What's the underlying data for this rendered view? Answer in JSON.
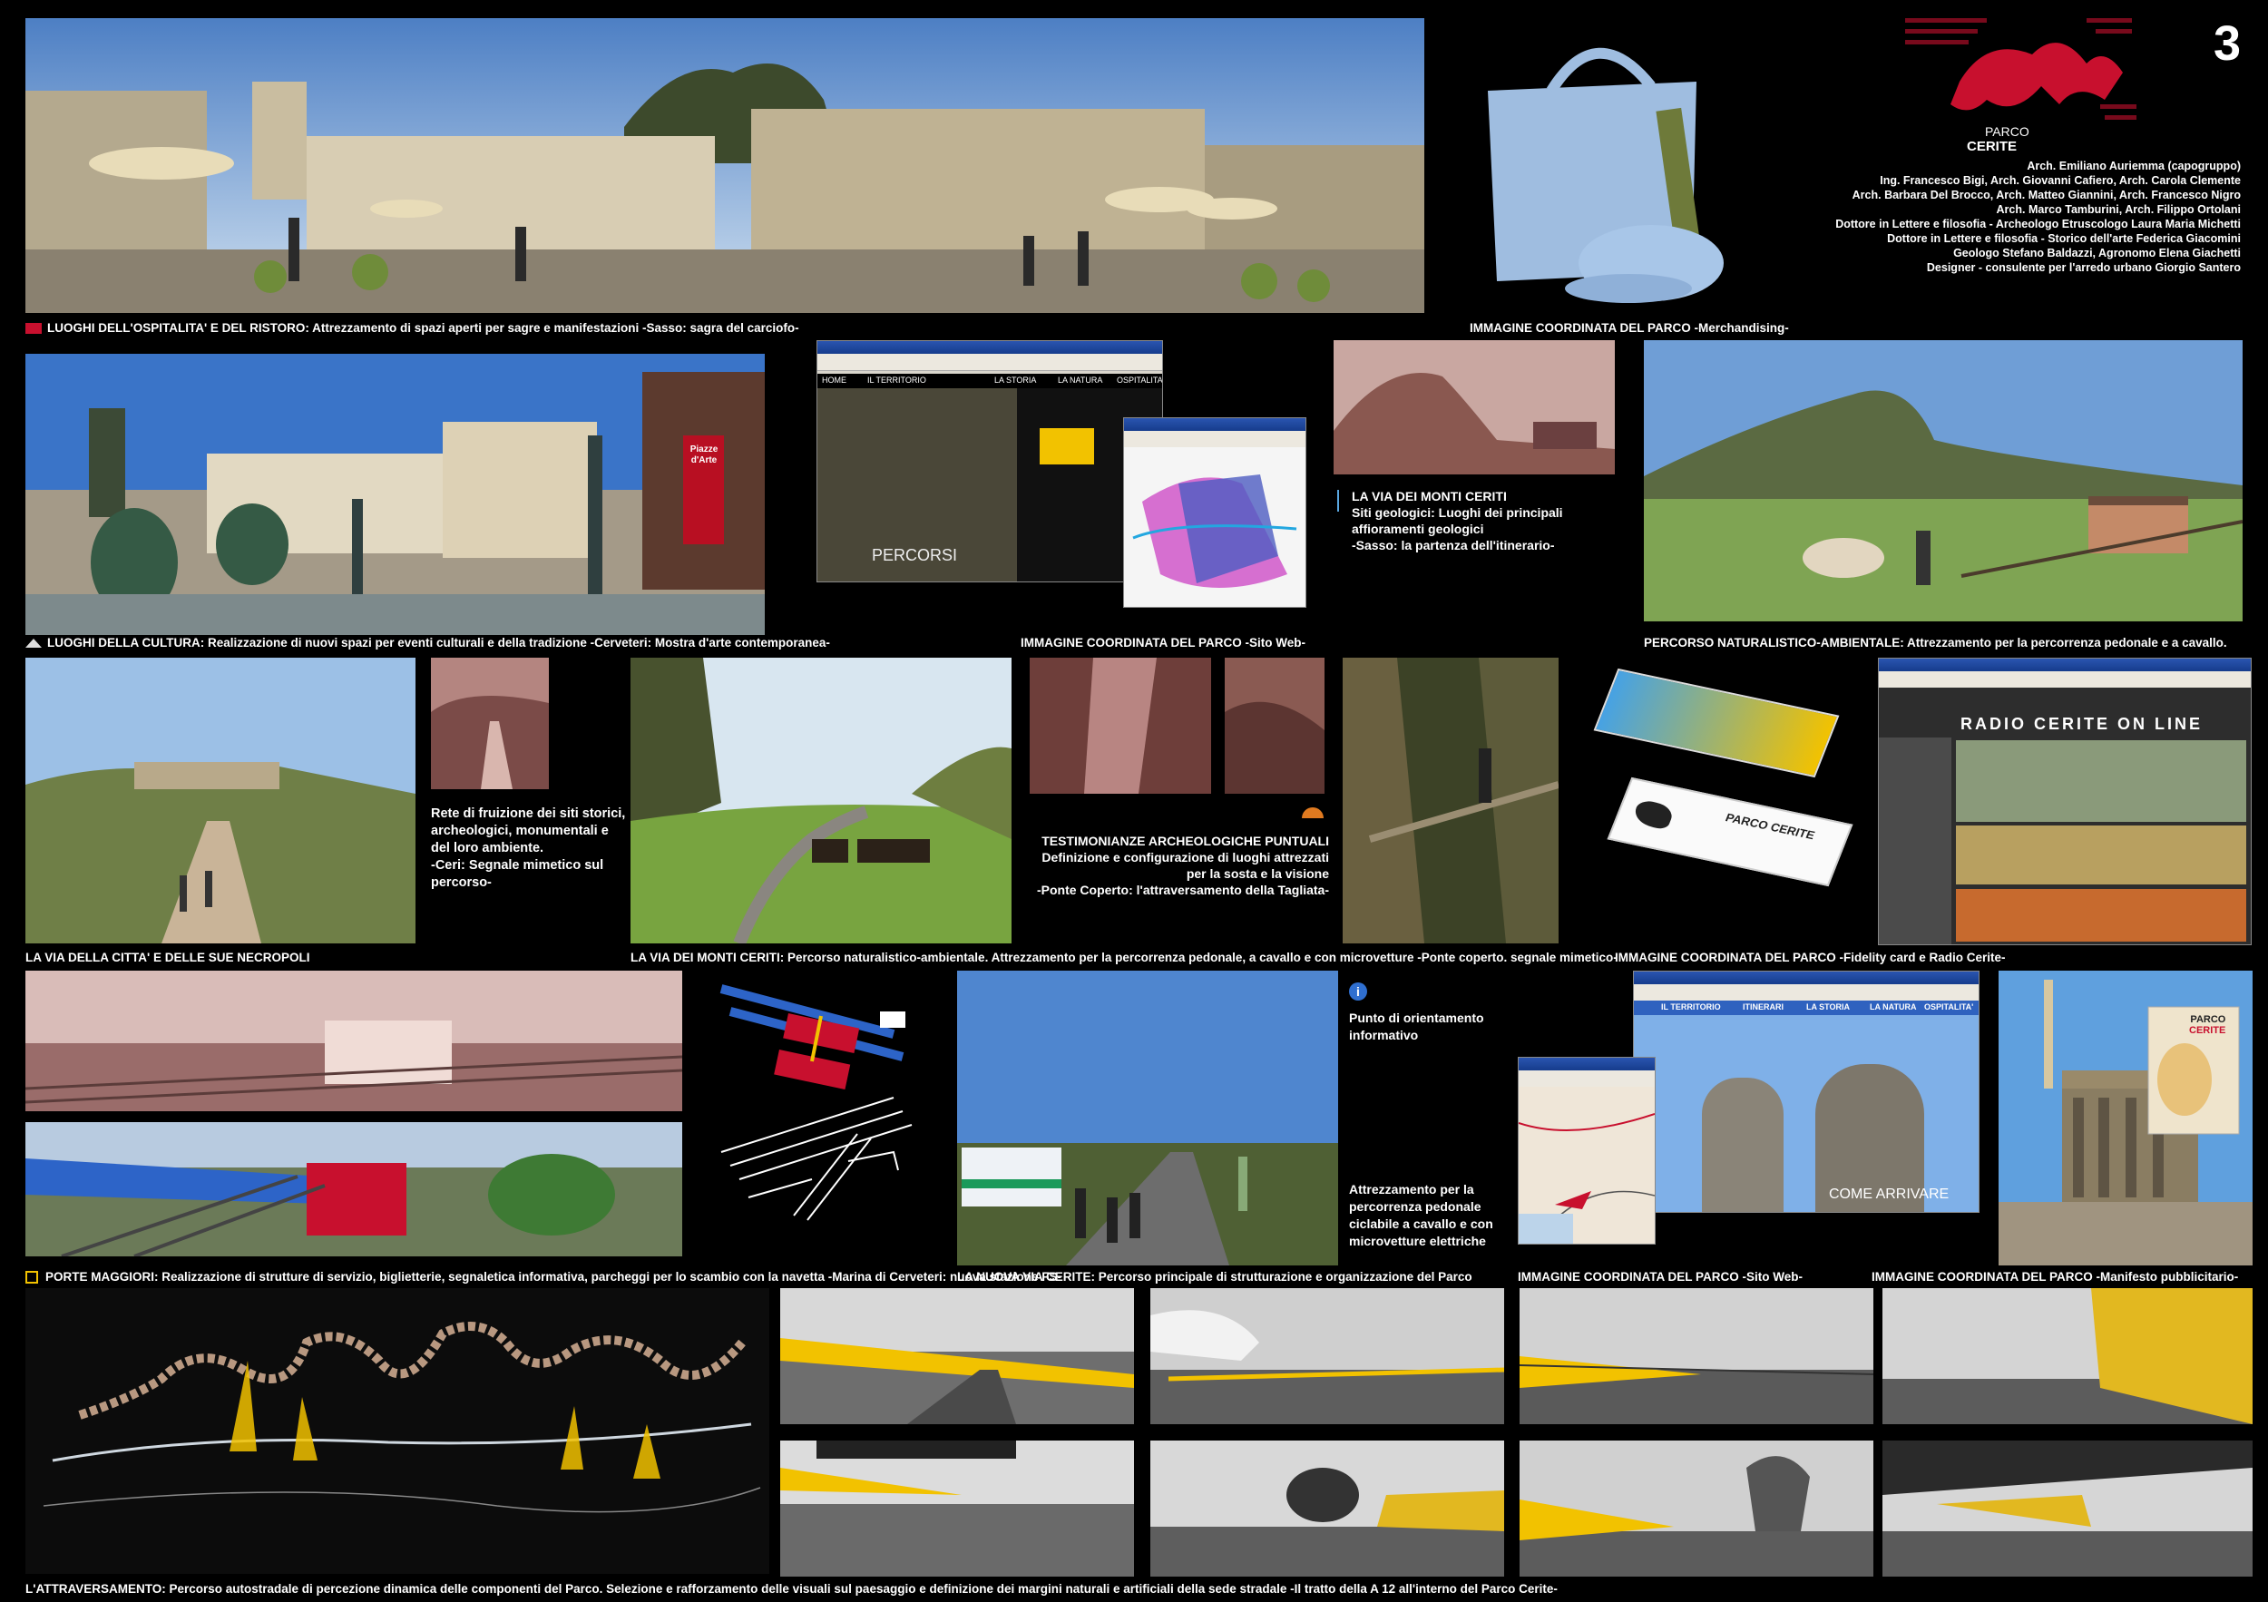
{
  "page_number": "3",
  "logo": {
    "title": "PARCO",
    "subtitle": "CERITE"
  },
  "credits": [
    "Arch. Emiliano Auriemma (capogruppo)",
    "Ing. Francesco Bigi, Arch. Giovanni Cafiero, Arch. Carola Clemente",
    "Arch. Barbara  Del Brocco, Arch. Matteo Giannini, Arch. Francesco Nigro",
    "Arch. Marco Tamburini, Arch. Filippo Ortolani",
    "Dottore in Lettere e filosofia - Archeologo Etruscologo Laura Maria Michetti",
    "Dottore in Lettere e filosofia - Storico dell'arte Federica Giacomini",
    "Geologo Stefano Baldazzi, Agronomo Elena Giachetti",
    "Designer - consulente per l'arredo urbano Giorgio Santero"
  ],
  "captions": {
    "ospitalita": {
      "head": "LUOGHI DELL'OSPITALITA' E DEL RISTORO:",
      "body": " Attrezzamento di spazi aperti per sagre e manifestazioni -Sasso: sagra del carciofo-"
    },
    "merch": "IMMAGINE COORDINATA DEL PARCO -Merchandising-",
    "cultura": {
      "head": "LUOGHI DELLA CULTURA:",
      "body": " Realizzazione di nuovi spazi per eventi culturali e della tradizione -Cerveteri: Mostra d'arte contemporanea-"
    },
    "sito_web_1": "IMMAGINE COORDINATA DEL PARCO -Sito Web-",
    "naturalistico": {
      "head": "PERCORSO NATURALISTICO-AMBIENTALE:",
      "body": "  Attrezzamento per la percorrenza pedonale e a cavallo."
    },
    "via_monti_ceriti_1": [
      "LA VIA DEI MONTI CERITI",
      "Siti geologici: Luoghi dei principali",
      "affioramenti geologici",
      "-Sasso: la partenza dell'itinerario-"
    ],
    "rete_fruizione": [
      "Rete di fruizione dei siti storici,",
      "archeologici, monumentali e",
      "del loro ambiente.",
      "-Ceri: Segnale mimetico sul",
      "percorso-"
    ],
    "testimonianze": [
      "TESTIMONIANZE ARCHEOLOGICHE PUNTUALI",
      "Definizione e configurazione di luoghi attrezzati",
      "per la sosta e la visione",
      "-Ponte Coperto: l'attraversamento della Tagliata-"
    ],
    "via_citta": "LA VIA DELLA CITTA' E DELLE SUE NECROPOLI",
    "via_monti_ceriti_2": {
      "head": "LA VIA DEI MONTI CERITI:",
      "body": " Percorso naturalistico-ambientale.  Attrezzamento per la percorrenza pedonale, a cavallo e con microvetture -Ponte  coperto. segnale mimetico-"
    },
    "fidelity": "IMMAGINE COORDINATA DEL PARCO -Fidelity card e Radio Cerite-",
    "punto_orientamento": [
      "Punto di orientamento",
      "informativo"
    ],
    "attrezzamento": [
      "Attrezzamento per la",
      "percorrenza pedonale",
      "ciclabile a cavallo e con",
      "microvetture elettriche"
    ],
    "porte": {
      "head": "PORTE MAGGIORI:",
      "body": "  Realizzazione di strutture di servizio, biglietterie, segnaletica informativa, parcheggi per lo scambio con la navetta -Marina di Cerveteri: nuova  stazione FS-"
    },
    "nuova_via": {
      "head": "LA NUOVA VIA CERITE:",
      "body": " Percorso principale di strutturazione e organizzazione del Parco"
    },
    "sito_web_2": "IMMAGINE COORDINATA DEL PARCO -Sito Web-",
    "manifesto": "IMMAGINE COORDINATA DEL PARCO -Manifesto pubblicitario-",
    "attraversamento": {
      "head": "L'ATTRAVERSAMENTO:",
      "body": " Percorso autostradale di percezione dinamica delle componenti del Parco.  Selezione e rafforzamento delle visuali sul paesaggio e definizione dei margini naturali e artificiali della sede stradale -Il tratto della A 12 all'interno del Parco Cerite-"
    }
  },
  "image_labels": {
    "piazze_arte": [
      "Piazze",
      "d'Arte"
    ],
    "percorsi": "PERCORSI",
    "come_arrivare": "COME ARRIVARE",
    "radio": "RADIO CERITE ON LINE",
    "card_brand": "PARCO CERITE",
    "poster_brand": [
      "PARCO",
      "CERITE"
    ],
    "web_menu": [
      "HOME",
      "IL TERRITORIO",
      "LA STORIA",
      "LA NATURA",
      "OSPITALITA'"
    ],
    "web_menu_2": [
      "IL TERRITORIO",
      "ITINERARI",
      "LA STORIA",
      "LA NATURA",
      "OSPITALITA'"
    ]
  },
  "colors": {
    "background": "#000000",
    "brand_red": "#c8102e",
    "highlight_yellow": "#f2c200"
  }
}
